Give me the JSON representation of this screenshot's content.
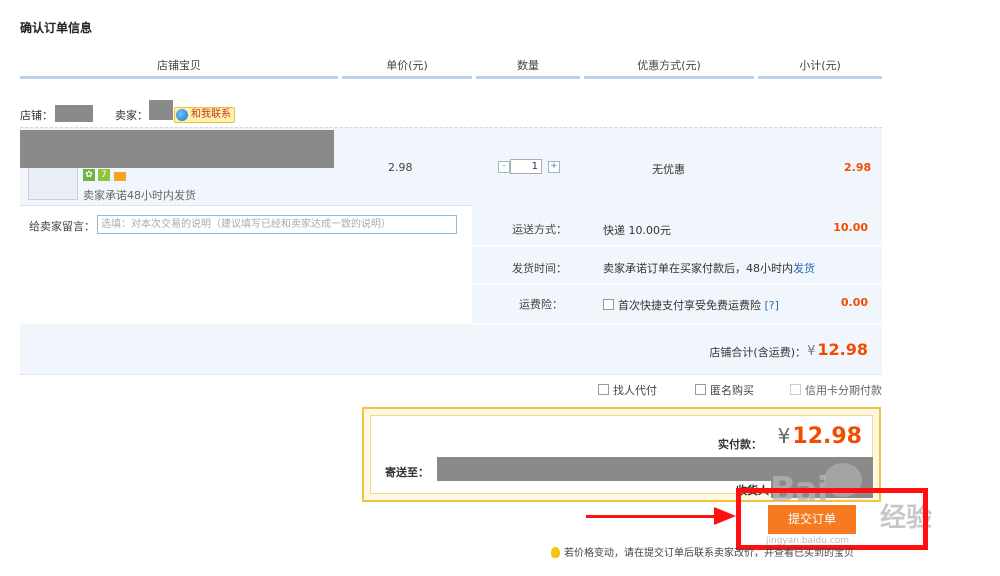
{
  "page_title": "确认订单信息",
  "columns": [
    "店铺宝贝",
    "单价(元)",
    "数量",
    "优惠方式(元)",
    "小计(元)"
  ],
  "shop": {
    "shop_label": "店铺：",
    "seller_label": "卖家：",
    "chat_label": "和我联系"
  },
  "item": {
    "promise": "卖家承诺48小时内发货",
    "badge_num": "7",
    "unit_price": "2.98",
    "quantity": "1",
    "minus_symbol": "-",
    "plus_symbol": "+",
    "discount": "无优惠",
    "subtotal": "2.98"
  },
  "message": {
    "label": "给卖家留言：",
    "placeholder": "选填：对本次交易的说明（建议填写已经和卖家达成一致的说明）"
  },
  "shipping": {
    "method_label": "运送方式：",
    "method_value": "快递 10.00元",
    "method_amount": "10.00",
    "time_label": "发货时间：",
    "time_value_prefix": "卖家承诺订单在买家付款后，48小时内",
    "time_value_link": "发货",
    "insurance_label": "运费险：",
    "insurance_value": "首次快捷支付享受免费运费险",
    "insurance_help": "[?]",
    "insurance_amount": "0.00"
  },
  "shop_total": {
    "label": "店铺合计(含运费)：",
    "currency": "¥",
    "amount": "12.98"
  },
  "options": {
    "proxy_pay": "找人代付",
    "anonymous": "匿名购买",
    "installment": "信用卡分期付款"
  },
  "payment": {
    "label": "实付款：",
    "currency": "¥",
    "amount": "12.98",
    "send_to_label": "寄送至：",
    "receiver_label": "收货人"
  },
  "submit_label": "提交订单",
  "tip_text": "若价格变动，请在提交订单后联系卖家改价，并查看已买到的宝贝",
  "watermark": {
    "brand": "Bai",
    "brand_cn": "经验",
    "url": "jingyan.baidu.com"
  },
  "colors": {
    "accent": "#f24c00",
    "header_border": "#b9d3ee",
    "panel_bg": "#f1f6fc",
    "annotation": "#ff1010",
    "pay_border": "#f5c046"
  }
}
